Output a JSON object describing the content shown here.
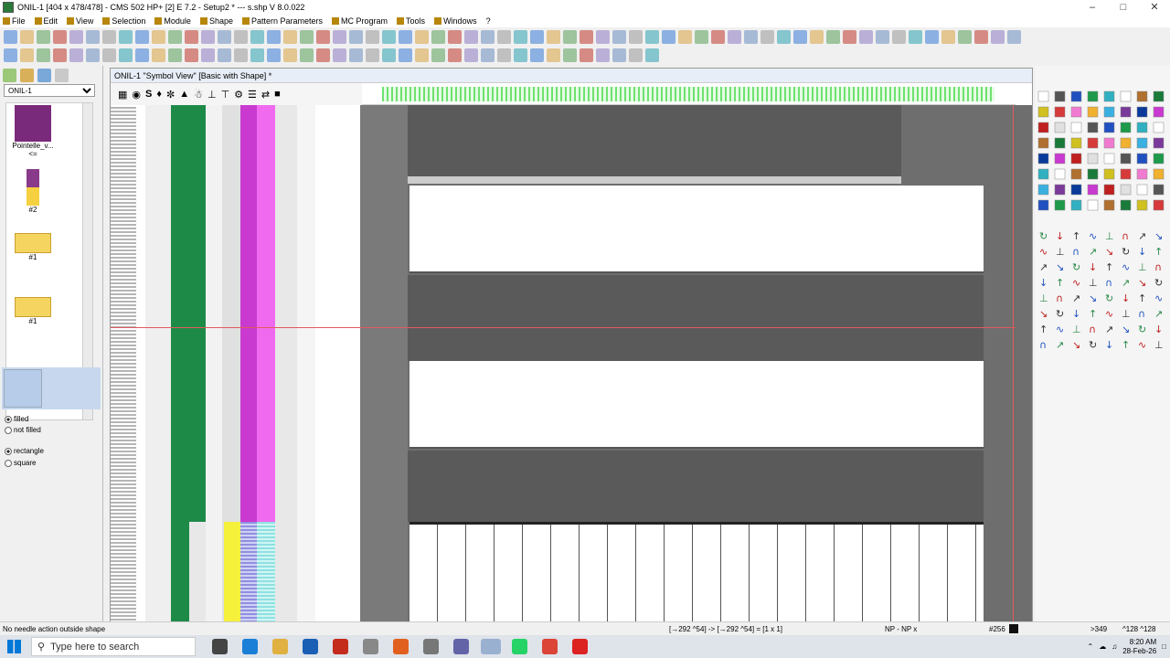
{
  "window": {
    "title": "ONIL-1 [404 x 478/478] - CMS 502 HP+ [2] E 7.2 - Setup2 * --- s.shp   V 8.0.022"
  },
  "menu": [
    "File",
    "Edit",
    "View",
    "Selection",
    "Module",
    "Shape",
    "Pattern Parameters",
    "MC Program",
    "Tools",
    "Windows",
    "?"
  ],
  "toolbar": {
    "zoom_value": "4",
    "step_values": [
      "1",
      "2",
      "3",
      "4",
      "5"
    ]
  },
  "left_panel": {
    "pattern_select": "ONIL-1",
    "thumbs": [
      {
        "label": "Pointelle_v...",
        "sub": "<="
      },
      {
        "label": "#2"
      },
      {
        "label": "#1"
      },
      {
        "label": "#1"
      }
    ],
    "fill_options": [
      {
        "label": "filled",
        "checked": true
      },
      {
        "label": "not filled",
        "checked": false
      }
    ],
    "shape_options": [
      {
        "label": "rectangle",
        "checked": true
      },
      {
        "label": "square",
        "checked": false
      }
    ]
  },
  "document": {
    "title": "ONIL-1 \"Symbol View\" [Basic with Shape] *"
  },
  "status": {
    "left": "No needle action outside shape",
    "coords": "[→292 ^54] -> [→292 ^54] = [1 x 1]",
    "np": "NP - NP x",
    "count": "#256",
    "right1": ">349",
    "right2": "^128 ^128"
  },
  "taskbar": {
    "search_placeholder": "Type here to search",
    "time": "8:20 AM",
    "date": "28-Feb-26"
  },
  "colors": {
    "accent": "#0078d7",
    "stripe_green": "#1e8a48",
    "stripe_magenta": "#c83ad0",
    "stripe_pink": "#f06af0",
    "yellow": "#f5f03a",
    "cyan": "#8fe0e0"
  }
}
